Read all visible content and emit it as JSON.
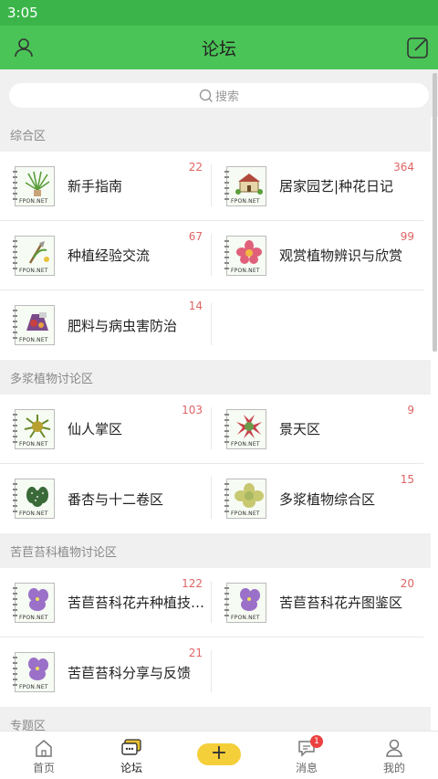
{
  "status_bar": {
    "time": "3:05"
  },
  "header": {
    "title": "论坛"
  },
  "search": {
    "placeholder": "搜索"
  },
  "sections": [
    {
      "title": "综合区",
      "items": [
        {
          "title": "新手指南",
          "count": "22",
          "icon": "spider-plant-thumbnail"
        },
        {
          "title": "居家园艺|种花日记",
          "count": "364",
          "icon": "house-garden-thumbnail"
        },
        {
          "title": "种植经验交流",
          "count": "67",
          "icon": "gardening-tools-thumbnail"
        },
        {
          "title": "观赏植物辨识与欣赏",
          "count": "99",
          "icon": "pink-flower-thumbnail"
        },
        {
          "title": "肥料与病虫害防治",
          "count": "14",
          "icon": "fertilizer-thumbnail"
        }
      ]
    },
    {
      "title": "多浆植物讨论区",
      "items": [
        {
          "title": "仙人掌区",
          "count": "103",
          "icon": "cactus-thumbnail"
        },
        {
          "title": "景天区",
          "count": "9",
          "icon": "red-succulent-thumbnail"
        },
        {
          "title": "番杏与十二卷区",
          "count": "",
          "icon": "haworthia-thumbnail"
        },
        {
          "title": "多浆植物综合区",
          "count": "15",
          "icon": "echeveria-thumbnail"
        }
      ]
    },
    {
      "title": "苦苣苔科植物讨论区",
      "items": [
        {
          "title": "苦苣苔科花卉种植技术…",
          "count": "122",
          "icon": "purple-flower-thumbnail"
        },
        {
          "title": "苦苣苔科花卉图鉴区",
          "count": "20",
          "icon": "purple-flower-thumbnail"
        },
        {
          "title": "苦苣苔科分享与反馈",
          "count": "21",
          "icon": "purple-flower-thumbnail"
        }
      ]
    },
    {
      "title": "专题区",
      "items": []
    }
  ],
  "thumb_logo": "FPON.NET",
  "tab_bar": {
    "home": "首页",
    "forum": "论坛",
    "add": "+",
    "messages": "消息",
    "messages_badge": "1",
    "mine": "我的"
  },
  "colors": {
    "header": "#4ac456",
    "status_bar": "#3bb54a",
    "count": "#e06464",
    "add_button": "#f5cf3a",
    "badge": "#ec4141"
  }
}
